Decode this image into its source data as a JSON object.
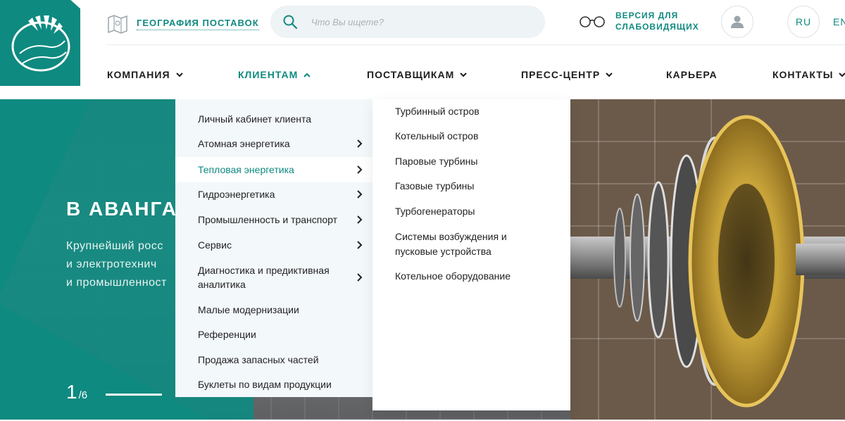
{
  "header": {
    "geo_label": "ГЕОГРАФИЯ ПОСТАВОК",
    "search_placeholder": "Что Вы ищете?",
    "vision_line1": "ВЕРСИЯ ДЛЯ",
    "vision_line2": "СЛАБОВИДЯЩИХ",
    "lang_ru": "RU",
    "lang_en": "EN"
  },
  "nav": {
    "items": [
      {
        "label": "КОМПАНИЯ"
      },
      {
        "label": "КЛИЕНТАМ"
      },
      {
        "label": "ПОСТАВЩИКАМ"
      },
      {
        "label": "ПРЕСС-ЦЕНТР"
      },
      {
        "label": "КАРЬЕРА"
      },
      {
        "label": "КОНТАКТЫ"
      }
    ]
  },
  "clients_menu": {
    "items": [
      {
        "label": "Личный кабинет клиента"
      },
      {
        "label": "Атомная энергетика"
      },
      {
        "label": "Тепловая энергетика"
      },
      {
        "label": "Гидроэнергетика"
      },
      {
        "label": "Промышленность и транспорт"
      },
      {
        "label": "Сервис"
      },
      {
        "label": "Диагностика и предиктивная аналитика"
      },
      {
        "label": "Малые модернизации"
      },
      {
        "label": "Референции"
      },
      {
        "label": "Продажа запасных частей"
      },
      {
        "label": "Буклеты по видам продукции"
      }
    ]
  },
  "thermal_menu": {
    "items": [
      {
        "label": "Турбинный остров"
      },
      {
        "label": "Котельный остров"
      },
      {
        "label": "Паровые турбины"
      },
      {
        "label": "Газовые турбины"
      },
      {
        "label": "Турбогенераторы"
      },
      {
        "label": "Системы возбуждения и пусковые устройства"
      },
      {
        "label": "Котельное оборудование"
      }
    ]
  },
  "hero": {
    "title": "В АВАНГАР",
    "text_line1": "Крупнейший росс",
    "text_line2": "и электротехнич",
    "text_line3": "и промышленност",
    "pager_current": "1",
    "pager_total": "/6"
  },
  "colors": {
    "brand": "#0f8a80",
    "menu_bg": "#f3f8fb"
  }
}
